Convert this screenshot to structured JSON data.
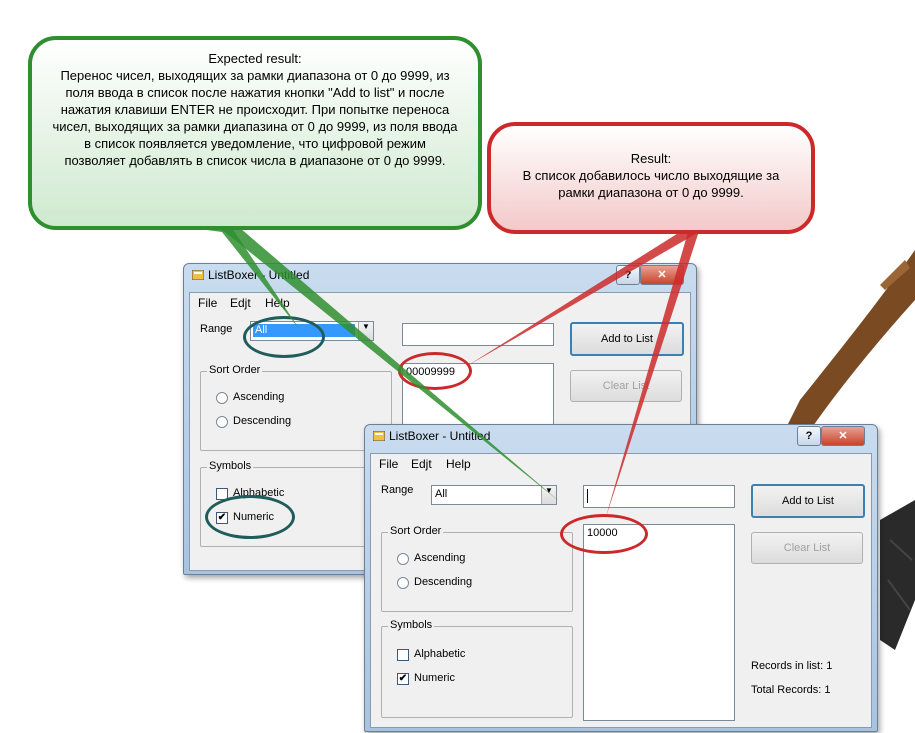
{
  "bubbles": {
    "expected_title": "Expected result:",
    "expected_text": "Перенос чисел, выходящих за рамки диапазона от 0 до 9999,  из поля ввода в список после нажатия кнопки \"Add to list\" и после нажатия клавиши ENTER не происходит. При попытке переноса чисел, выходящих за рамки диапазина от 0 до 9999, из поля ввода в список появляется уведомление, что цифровой режим позволяет добавлять в список числа в диапазоне от 0 до 9999.",
    "result_title": "Result:",
    "result_text": "В список добавилось число выходящие за рамки диапазона от 0 до 9999."
  },
  "win1": {
    "title": "ListBoxer - Untitled",
    "help_btn": "?",
    "close_btn": "✕",
    "menu": [
      "File",
      "Edjt",
      "Help"
    ],
    "range_label": "Range",
    "range_value": "All",
    "input_value": "",
    "list_items": [
      "00009999"
    ],
    "add_button": "Add to List",
    "clear_button": "Clear List",
    "sort_order_label": "Sort Order",
    "ascending": "Ascending",
    "descending": "Descending",
    "symbols_label": "Symbols",
    "alphabetic": "Alphabetic",
    "numeric": "Numeric",
    "numeric_checked": true,
    "alphabetic_checked": false
  },
  "win2": {
    "title": "ListBoxer - Untitled",
    "help_btn": "?",
    "close_btn": "✕",
    "menu": [
      "File",
      "Edjt",
      "Help"
    ],
    "range_label": "Range",
    "range_value": "All",
    "input_value": "",
    "list_items": [
      "10000"
    ],
    "add_button": "Add to List",
    "clear_button": "Clear List",
    "sort_order_label": "Sort Order",
    "ascending": "Ascending",
    "descending": "Descending",
    "symbols_label": "Symbols",
    "alphabetic": "Alphabetic",
    "numeric": "Numeric",
    "numeric_checked": true,
    "alphabetic_checked": false,
    "records_in_list": "Records in list: 1",
    "total_records": "Total Records: 1"
  },
  "colors": {
    "green_accent": "#2f8f2f",
    "red_accent": "#cc2a2a",
    "teal_highlight": "#1f5c5c",
    "selection_blue": "#3399ff"
  }
}
